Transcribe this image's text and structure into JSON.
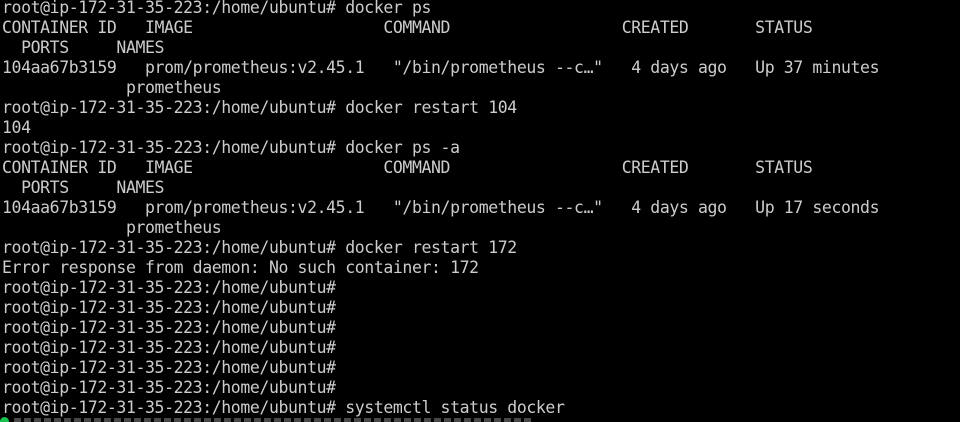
{
  "terminal": {
    "lines": [
      "root@ip-172-31-35-223:/home/ubuntu# docker ps",
      "CONTAINER ID   IMAGE                    COMMAND                  CREATED       STATUS",
      "  PORTS     NAMES",
      "104aa67b3159   prom/prometheus:v2.45.1   \"/bin/prometheus --c…\"   4 days ago   Up 37 minutes",
      "             prometheus",
      "root@ip-172-31-35-223:/home/ubuntu# docker restart 104",
      "104",
      "root@ip-172-31-35-223:/home/ubuntu# docker ps -a",
      "CONTAINER ID   IMAGE                    COMMAND                  CREATED       STATUS",
      "  PORTS     NAMES",
      "104aa67b3159   prom/prometheus:v2.45.1   \"/bin/prometheus --c…\"   4 days ago   Up 17 seconds",
      "             prometheus",
      "root@ip-172-31-35-223:/home/ubuntu# docker restart 172",
      "Error response from daemon: No such container: 172",
      "root@ip-172-31-35-223:/home/ubuntu#",
      "root@ip-172-31-35-223:/home/ubuntu#",
      "root@ip-172-31-35-223:/home/ubuntu#",
      "root@ip-172-31-35-223:/home/ubuntu#",
      "root@ip-172-31-35-223:/home/ubuntu#",
      "root@ip-172-31-35-223:/home/ubuntu#",
      "root@ip-172-31-35-223:/home/ubuntu# systemctl status docker"
    ],
    "colors": {
      "background": "#000000",
      "foreground": "#cccccc",
      "status_dot": "#19c34d"
    }
  }
}
